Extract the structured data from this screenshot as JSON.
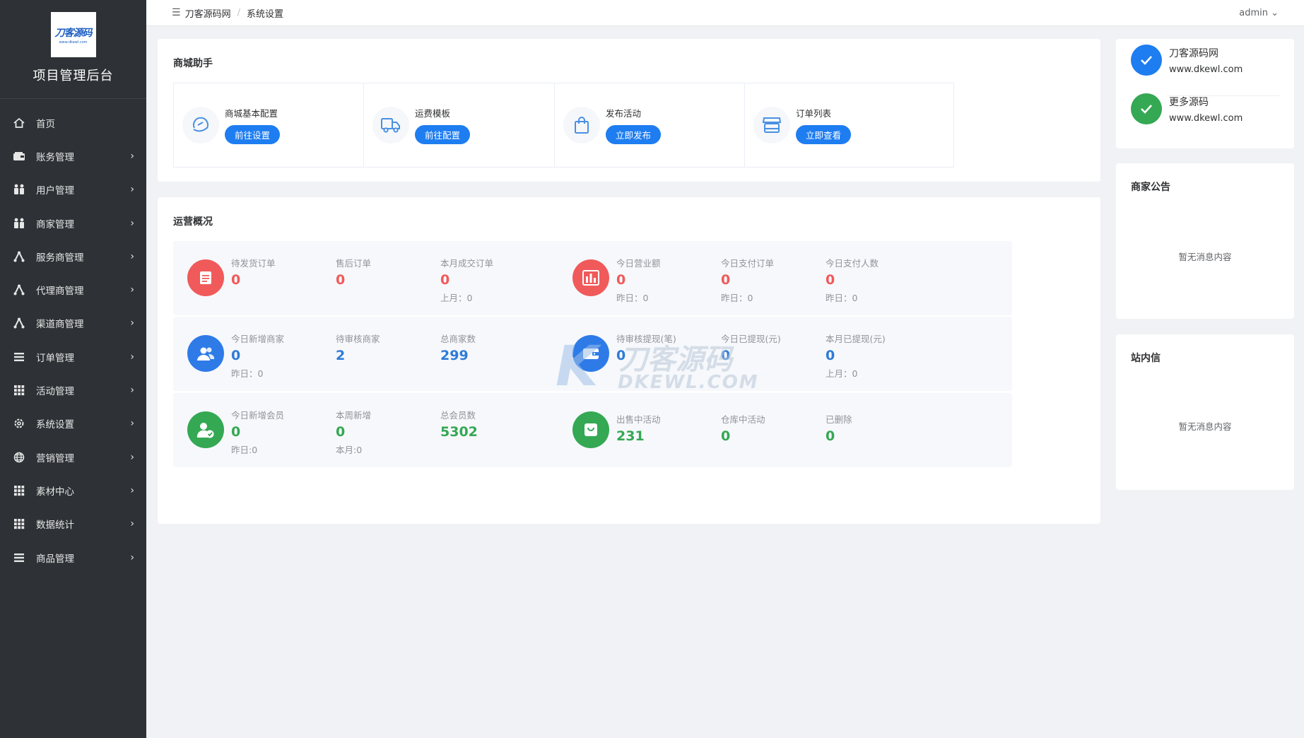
{
  "sidebar": {
    "logo_text": "刀客源码",
    "logo_sub": "www.dkewl.com",
    "app_title": "项目管理后台",
    "items": [
      {
        "label": "首页",
        "icon": "home-icon",
        "has_arrow": false
      },
      {
        "label": "账务管理",
        "icon": "wallet-icon",
        "has_arrow": true
      },
      {
        "label": "用户管理",
        "icon": "users-icon",
        "has_arrow": true
      },
      {
        "label": "商家管理",
        "icon": "users-icon",
        "has_arrow": true
      },
      {
        "label": "服务商管理",
        "icon": "network-icon",
        "has_arrow": true
      },
      {
        "label": "代理商管理",
        "icon": "network-icon",
        "has_arrow": true
      },
      {
        "label": "渠道商管理",
        "icon": "network-icon",
        "has_arrow": true
      },
      {
        "label": "订单管理",
        "icon": "list-icon",
        "has_arrow": true
      },
      {
        "label": "活动管理",
        "icon": "grid-icon",
        "has_arrow": true
      },
      {
        "label": "系统设置",
        "icon": "gear-icon",
        "has_arrow": true
      },
      {
        "label": "营销管理",
        "icon": "globe-icon",
        "has_arrow": true
      },
      {
        "label": "素材中心",
        "icon": "grid-icon",
        "has_arrow": true
      },
      {
        "label": "数据统计",
        "icon": "grid-icon",
        "has_arrow": true
      },
      {
        "label": "商品管理",
        "icon": "list-icon",
        "has_arrow": true
      }
    ]
  },
  "header": {
    "breadcrumb": [
      "刀客源码网",
      "系统设置"
    ],
    "separator": "/",
    "user": "admin ⌄"
  },
  "helper": {
    "title": "商城助手",
    "items": [
      {
        "name": "商城基本配置",
        "button": "前往设置",
        "icon": "settings-gauge-icon"
      },
      {
        "name": "运费模板",
        "button": "前往配置",
        "icon": "truck-icon"
      },
      {
        "name": "发布活动",
        "button": "立即发布",
        "icon": "shopping-bag-icon"
      },
      {
        "name": "订单列表",
        "button": "立即查看",
        "icon": "store-icon"
      }
    ]
  },
  "ops": {
    "title": "运营概况",
    "blocks": [
      {
        "icon": "order-icon",
        "color": "#f05a5a",
        "value_class": "red",
        "cols": [
          {
            "label": "待发货订单",
            "value": "0",
            "sub": ""
          },
          {
            "label": "售后订单",
            "value": "0",
            "sub": ""
          },
          {
            "label": "本月成交订单",
            "value": "0",
            "sub": "上月：0"
          }
        ]
      },
      {
        "icon": "bar-chart-icon",
        "color": "#f05a5a",
        "value_class": "red",
        "cols": [
          {
            "label": "今日营业额",
            "value": "0",
            "sub": "昨日：0"
          },
          {
            "label": "今日支付订单",
            "value": "0",
            "sub": "昨日：0"
          },
          {
            "label": "今日支付人数",
            "value": "0",
            "sub": "昨日：0"
          }
        ]
      },
      {
        "icon": "merchant-users-icon",
        "color": "#2e7be8",
        "value_class": "blue",
        "cols": [
          {
            "label": "今日新增商家",
            "value": "0",
            "sub": "昨日：0"
          },
          {
            "label": "待审核商家",
            "value": "2",
            "sub": ""
          },
          {
            "label": "总商家数",
            "value": "299",
            "sub": ""
          }
        ]
      },
      {
        "icon": "wallet-card-icon",
        "color": "#2e7be8",
        "value_class": "blue",
        "cols": [
          {
            "label": "待审核提现(笔)",
            "value": "0",
            "sub": ""
          },
          {
            "label": "今日已提现(元)",
            "value": "0",
            "sub": ""
          },
          {
            "label": "本月已提现(元)",
            "value": "0",
            "sub": "上月：0"
          }
        ]
      },
      {
        "icon": "member-check-icon",
        "color": "#34a853",
        "value_class": "green",
        "cols": [
          {
            "label": "今日新增会员",
            "value": "0",
            "sub": "昨日:0"
          },
          {
            "label": "本周新增",
            "value": "0",
            "sub": "本月:0"
          },
          {
            "label": "总会员数",
            "value": "5302",
            "sub": ""
          }
        ]
      },
      {
        "icon": "bag-icon",
        "color": "#34a853",
        "value_class": "green",
        "cols": [
          {
            "label": "出售中活动",
            "value": "231",
            "sub": ""
          },
          {
            "label": "仓库中活动",
            "value": "0",
            "sub": ""
          },
          {
            "label": "已删除",
            "value": "0",
            "sub": ""
          }
        ]
      }
    ]
  },
  "links": [
    {
      "name": "刀客源码网",
      "url": "www.dkewl.com",
      "color": "#1e7df0"
    },
    {
      "name": "更多源码",
      "url": "www.dkewl.com",
      "color": "#34a853"
    }
  ],
  "notice": {
    "title": "商家公告",
    "empty": "暂无消息内容"
  },
  "inbox": {
    "title": "站内信",
    "empty": "暂无消息内容"
  },
  "watermark": {
    "k": "K",
    "cn": "刀客源码",
    "en": "DKEWL.COM"
  }
}
